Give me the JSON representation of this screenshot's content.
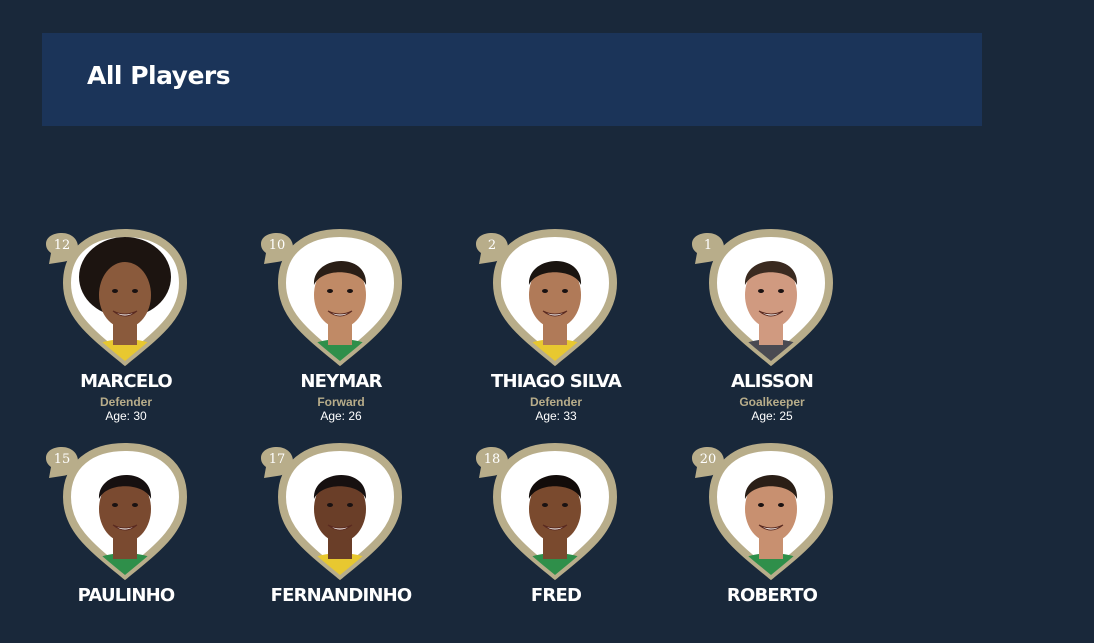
{
  "header": {
    "title": "All Players"
  },
  "players": [
    {
      "number": "12",
      "name": "MARCELO",
      "position": "Defender",
      "age_label": "Age:",
      "age": "30",
      "skin": "#8a5a3c",
      "hair": "#1c1410",
      "shirt": "#e8c830",
      "afro": true
    },
    {
      "number": "10",
      "name": "NEYMAR",
      "position": "Forward",
      "age_label": "Age:",
      "age": "26",
      "skin": "#c08a66",
      "hair": "#2a1e16",
      "shirt": "#2f8f4a",
      "afro": false
    },
    {
      "number": "2",
      "name": "THIAGO SILVA",
      "position": "Defender",
      "age_label": "Age:",
      "age": "33",
      "skin": "#b07a58",
      "hair": "#1a1410",
      "shirt": "#e8c830",
      "afro": false
    },
    {
      "number": "1",
      "name": "ALISSON",
      "position": "Goalkeeper",
      "age_label": "Age:",
      "age": "25",
      "skin": "#d09a80",
      "hair": "#3a2a20",
      "shirt": "#4a4a52",
      "afro": false
    },
    {
      "number": "15",
      "name": "PAULINHO",
      "position": "",
      "age_label": "",
      "age": "",
      "skin": "#7a4a30",
      "hair": "#161010",
      "shirt": "#2f8f4a",
      "afro": false
    },
    {
      "number": "17",
      "name": "FERNANDINHO",
      "position": "",
      "age_label": "",
      "age": "",
      "skin": "#6a3e28",
      "hair": "#161010",
      "shirt": "#e8c830",
      "afro": false
    },
    {
      "number": "18",
      "name": "FRED",
      "position": "",
      "age_label": "",
      "age": "",
      "skin": "#7a4a2e",
      "hair": "#120c0a",
      "shirt": "#2f8f4a",
      "afro": false
    },
    {
      "number": "20",
      "name": "ROBERTO",
      "position": "",
      "age_label": "",
      "age": "",
      "skin": "#c89070",
      "hair": "#2a1e16",
      "shirt": "#2f8f4a",
      "afro": false
    }
  ],
  "colors": {
    "background": "#19283a",
    "header": "#1b3459",
    "badge_gold": "#b8ad8a",
    "position_text": "#b8ad8a"
  }
}
